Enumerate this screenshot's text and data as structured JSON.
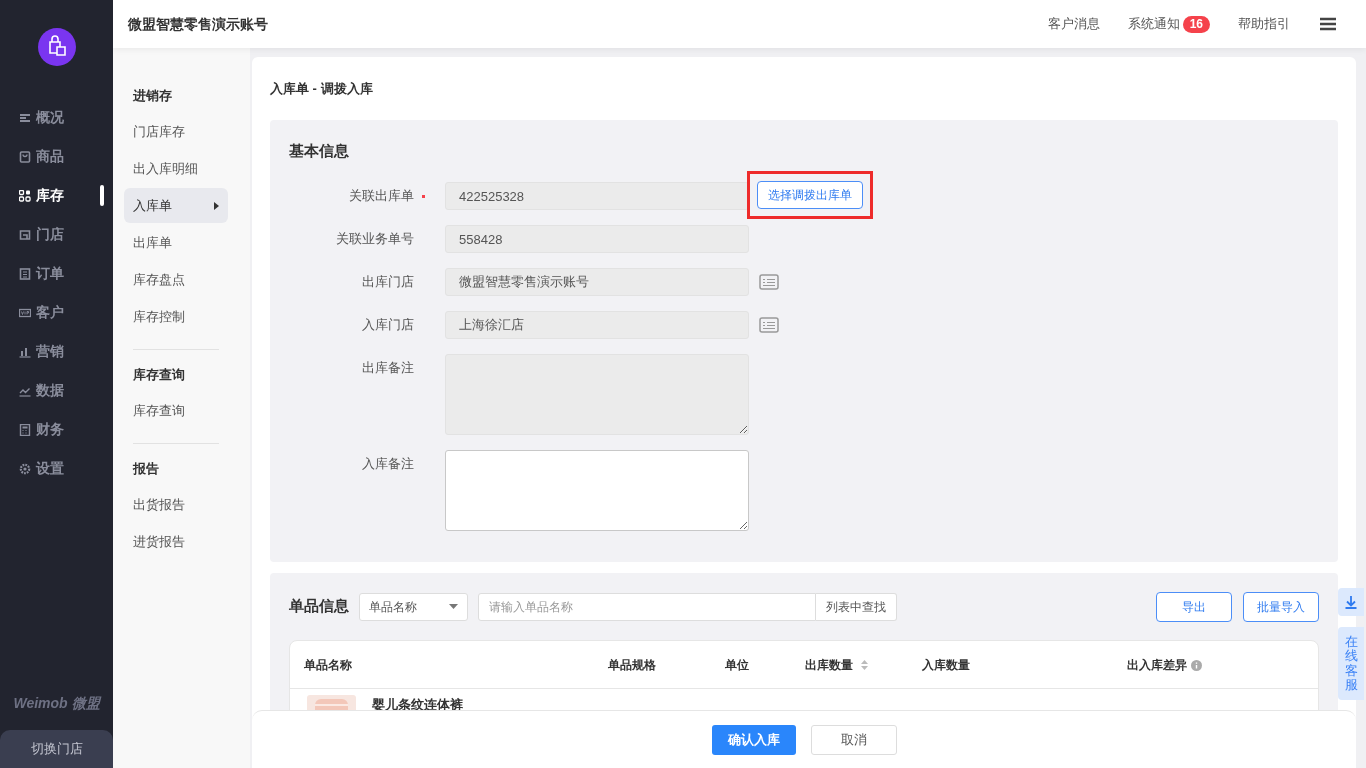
{
  "sidebar": {
    "logo": {
      "kind": "bag"
    },
    "items": [
      {
        "label": "概况",
        "selected": false
      },
      {
        "label": "商品",
        "selected": false
      },
      {
        "label": "库存",
        "selected": true
      },
      {
        "label": "门店",
        "selected": false
      },
      {
        "label": "订单",
        "selected": false
      },
      {
        "label": "客户",
        "selected": false
      },
      {
        "label": "营销",
        "selected": false
      },
      {
        "label": "数据",
        "selected": false
      },
      {
        "label": "财务",
        "selected": false
      },
      {
        "label": "设置",
        "selected": false
      }
    ],
    "brand": "Weimob 微盟",
    "switch_store": "切换门店"
  },
  "header": {
    "title": "微盟智慧零售演示账号",
    "links": [
      {
        "label": "客户消息"
      },
      {
        "label": "系统通知",
        "badge": "16"
      },
      {
        "label": "帮助指引"
      }
    ]
  },
  "subnav": [
    {
      "title": "进销存",
      "items": [
        {
          "label": "门店库存",
          "selected": false
        },
        {
          "label": "出入库明细",
          "selected": false
        },
        {
          "label": "入库单",
          "selected": true
        },
        {
          "label": "出库单",
          "selected": false
        },
        {
          "label": "库存盘点",
          "selected": false
        },
        {
          "label": "库存控制",
          "selected": false
        }
      ]
    },
    {
      "title": "库存查询",
      "items": [
        {
          "label": "库存查询",
          "selected": false
        }
      ]
    },
    {
      "title": "报告",
      "items": [
        {
          "label": "出货报告",
          "selected": false
        },
        {
          "label": "进货报告",
          "selected": false
        }
      ]
    }
  ],
  "breadcrumb": "入库单 - 调拨入库",
  "basic_info": {
    "title": "基本信息",
    "fields": [
      {
        "label": "关联出库单",
        "required": true,
        "kind": "input",
        "value": "422525328",
        "disabled": true,
        "action": "选择调拨出库单",
        "highlighted": true,
        "picker": false
      },
      {
        "label": "关联业务单号",
        "required": false,
        "kind": "input",
        "value": "558428",
        "disabled": true,
        "picker": false
      },
      {
        "label": "出库门店",
        "required": false,
        "kind": "input",
        "value": "微盟智慧零售演示账号",
        "disabled": true,
        "picker": true
      },
      {
        "label": "入库门店",
        "required": false,
        "kind": "input",
        "value": "上海徐汇店",
        "disabled": true,
        "picker": true
      },
      {
        "label": "出库备注",
        "required": false,
        "kind": "textarea",
        "disabled": true,
        "picker": false
      },
      {
        "label": "入库备注",
        "required": false,
        "kind": "textarea",
        "disabled": false,
        "picker": false
      }
    ]
  },
  "items": {
    "title": "单品信息",
    "filter": {
      "value": "单品名称"
    },
    "search": {
      "placeholder": "请输入单品名称",
      "button": "列表中查找"
    },
    "buttons": [
      "导出",
      "批量导入"
    ],
    "table": {
      "columns": [
        {
          "label": "单品名称",
          "sortable": false,
          "info": false
        },
        {
          "label": "单品规格",
          "sortable": false,
          "info": false
        },
        {
          "label": "单位",
          "sortable": false,
          "info": false
        },
        {
          "label": "出库数量",
          "sortable": true,
          "info": false
        },
        {
          "label": "入库数量",
          "sortable": false,
          "info": false
        },
        {
          "label": "出入库差异",
          "sortable": false,
          "info": true
        }
      ],
      "rows": [
        {
          "name": "婴儿条纹连体裤",
          "kind": "picture"
        }
      ]
    }
  },
  "footer": {
    "confirm": "确认入库",
    "cancel": "取消"
  },
  "float": {
    "download": {
      "kind": "download"
    },
    "service": "在线客服"
  }
}
